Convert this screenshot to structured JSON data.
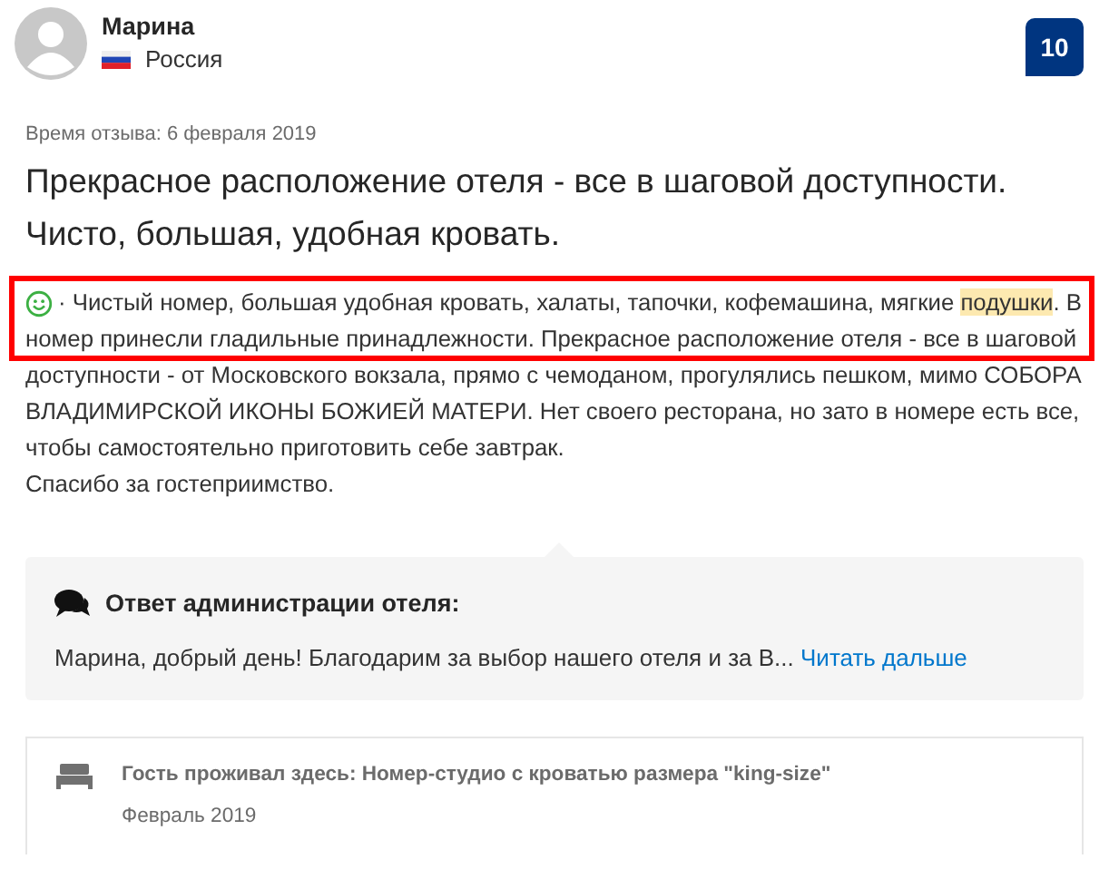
{
  "reviewer": {
    "name": "Марина",
    "country": "Россия"
  },
  "score": "10",
  "review_date": "Время отзыва: 6 февраля 2019",
  "title": "Прекрасное расположение отеля - все в шаговой доступности. Чисто, большая, удобная кровать.",
  "review": {
    "positive": true,
    "outlined": true,
    "parts": [
      {
        "text": " · Чистый номер, большая удобная кровать, халаты, тапочки, кофемашина, мягкие ",
        "highlighted": false
      },
      {
        "text": "подушки",
        "highlighted": true
      },
      {
        "text": ". В номер принесли гладильные принадлежности. Прекрасное расположение отеля - все в шаговой доступности - от Московского вокзала, прямо с чемоданом, прогулялись пешком, мимо СОБОРА ВЛАДИМИРСКОЙ ИКОНЫ БОЖИЕЙ МАТЕРИ. Нет своего ресторана, но зато в номере есть все, чтобы самостоятельно приготовить себе завтрак.\nСпасибо за гостеприимство.",
        "highlighted": false
      }
    ]
  },
  "hotel_response": {
    "heading": "Ответ администрации отеля:",
    "text": "Марина, добрый день! Благодарим за выбор нашего отеля и за В...",
    "link": "Читать дальше"
  },
  "stay": {
    "text": "Гость проживал здесь: Номер-студио с кроватью размера \"king-size\"",
    "date": "Февраль 2019"
  }
}
